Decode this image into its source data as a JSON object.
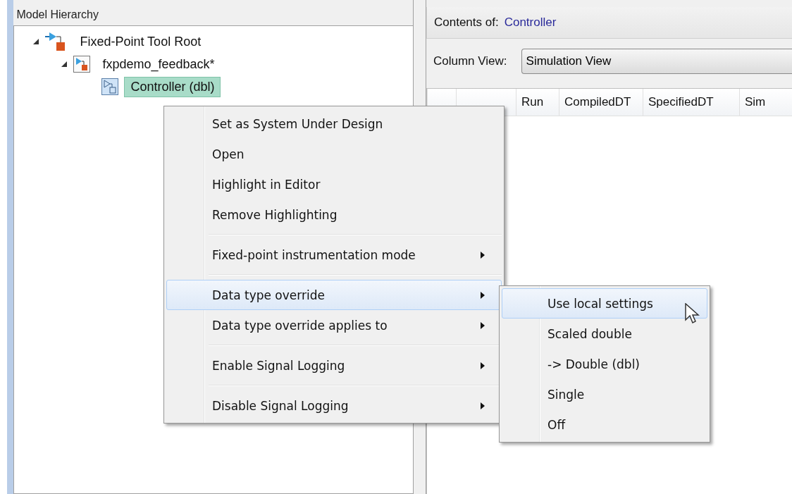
{
  "left_panel": {
    "title": "Model Hierarchy",
    "tree": [
      {
        "label": "Fixed-Point Tool Root",
        "expanded": true,
        "selected": false,
        "children": [
          {
            "label": "fxpdemo_feedback*",
            "expanded": true,
            "selected": false,
            "children": [
              {
                "label": "Controller (dbl)",
                "selected": true
              }
            ]
          }
        ]
      }
    ]
  },
  "right_panel": {
    "contents_label": "Contents of:",
    "contents_value": "Controller",
    "column_view_label": "Column View:",
    "column_view_value": "Simulation View",
    "table": {
      "columns": [
        "Run",
        "CompiledDT",
        "SpecifiedDT",
        "Sim"
      ]
    }
  },
  "context_menu": {
    "items": [
      {
        "kind": "item",
        "label": "Set as System Under Design",
        "submenu": false,
        "selected": false
      },
      {
        "kind": "item",
        "label": "Open",
        "submenu": false,
        "selected": false
      },
      {
        "kind": "item",
        "label": "Highlight in Editor",
        "submenu": false,
        "selected": false
      },
      {
        "kind": "item",
        "label": "Remove Highlighting",
        "submenu": false,
        "selected": false
      },
      {
        "kind": "separator"
      },
      {
        "kind": "item",
        "label": "Fixed-point instrumentation mode",
        "submenu": true,
        "selected": false
      },
      {
        "kind": "separator"
      },
      {
        "kind": "item",
        "label": "Data type override",
        "submenu": true,
        "selected": true
      },
      {
        "kind": "item",
        "label": "Data type override applies to",
        "submenu": true,
        "selected": false
      },
      {
        "kind": "separator"
      },
      {
        "kind": "item",
        "label": "Enable Signal Logging",
        "submenu": true,
        "selected": false
      },
      {
        "kind": "separator"
      },
      {
        "kind": "item",
        "label": "Disable Signal Logging",
        "submenu": true,
        "selected": false
      }
    ]
  },
  "submenu": {
    "items": [
      {
        "label": "Use local settings",
        "selected": true
      },
      {
        "label": "Scaled double",
        "selected": false
      },
      {
        "label": "-> Double (dbl)",
        "selected": false
      },
      {
        "label": "Single",
        "selected": false
      },
      {
        "label": "Off",
        "selected": false
      }
    ]
  }
}
